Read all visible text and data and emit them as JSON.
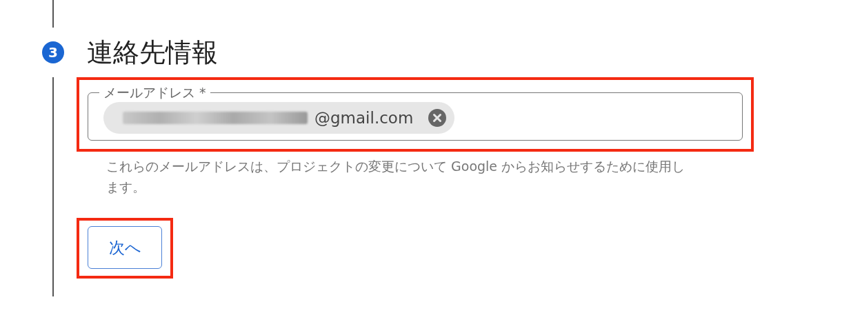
{
  "step": {
    "number": "3",
    "title": "連絡先情報"
  },
  "email_field": {
    "label": "メールアドレス *",
    "chip": {
      "value": "@gmail.com",
      "redacted": true
    },
    "highlighted": true
  },
  "helper_text": "これらのメールアドレスは、プロジェクトの変更について Google からお知らせするために使用します。",
  "next_button": {
    "label": "次へ",
    "highlighted": true
  }
}
